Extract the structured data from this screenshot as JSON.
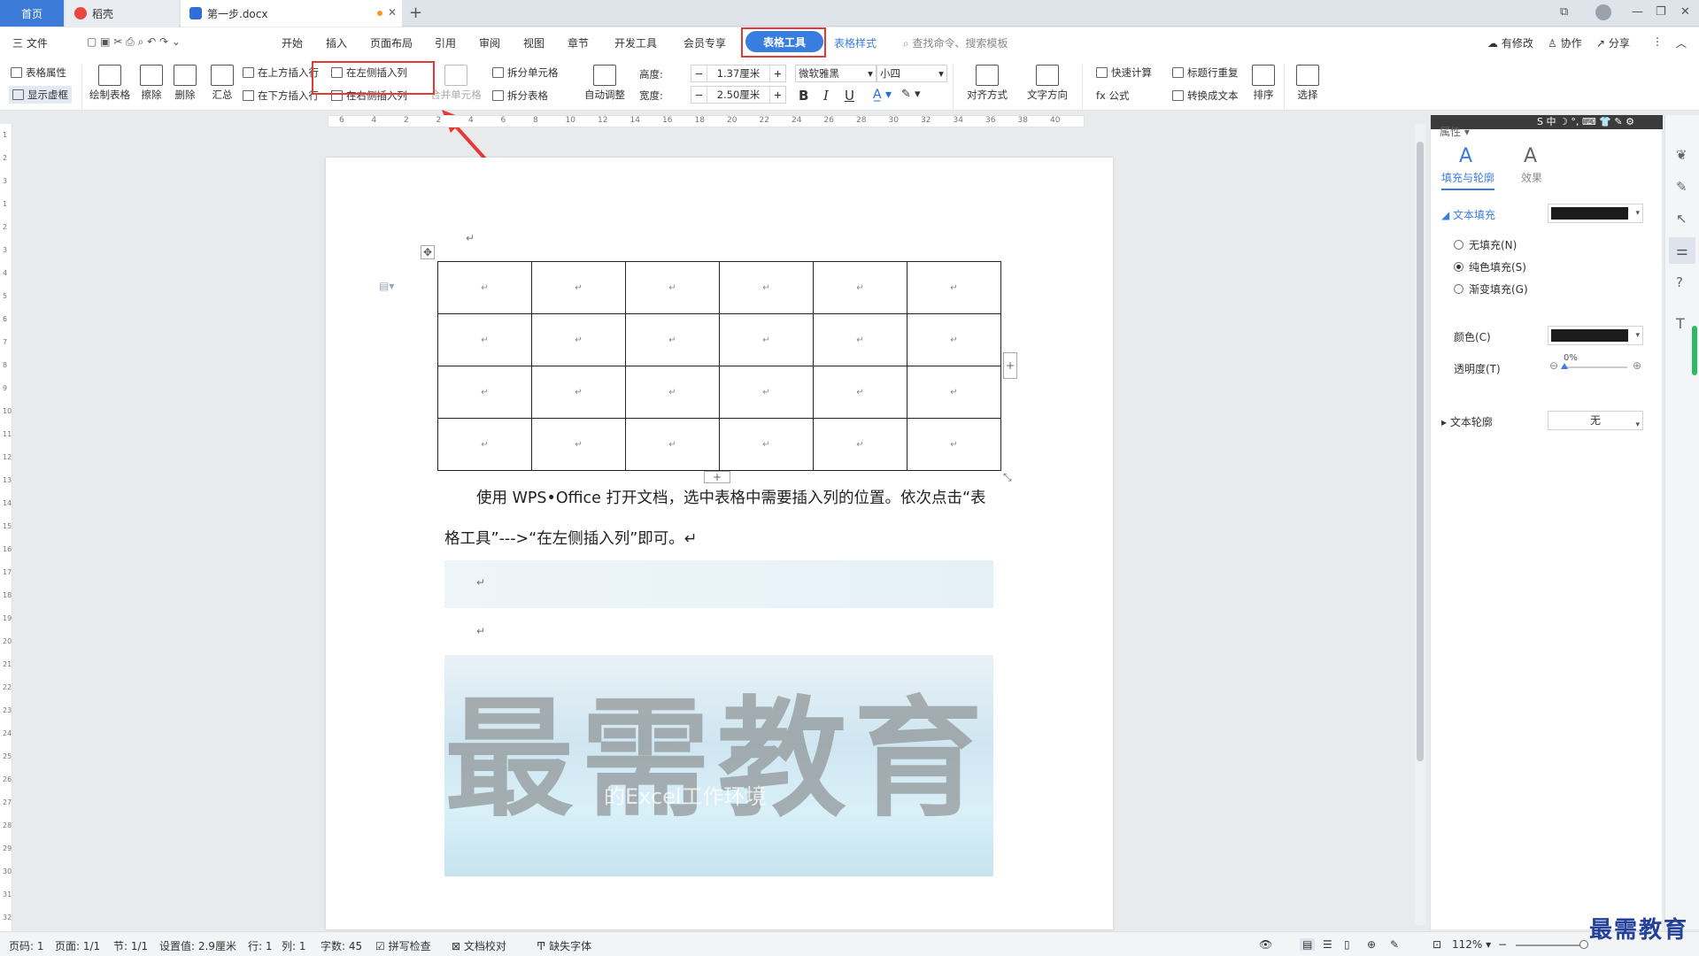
{
  "tabs": {
    "home": "首页",
    "daoke": "稻壳",
    "doc": "第一步.docx"
  },
  "menu": {
    "file": "三 文件",
    "items": [
      "开始",
      "插入",
      "页面布局",
      "引用",
      "审阅",
      "视图",
      "章节",
      "开发工具",
      "会员专享"
    ],
    "active": "表格工具",
    "table_style": "表格样式",
    "search": "查找命令、搜索模板",
    "modified": "有修改",
    "collab": "协作",
    "share": "分享"
  },
  "ribbon": {
    "table_props": "表格属性",
    "show_grid": "显示虚框",
    "draw_table": "绘制表格",
    "erase": "擦除",
    "delete": "删除",
    "summary": "汇总",
    "insert_above": "在上方插入行",
    "insert_below": "在下方插入行",
    "insert_left": "在左侧插入列",
    "insert_right": "在右侧插入列",
    "merge_cells": "合并单元格",
    "split_cells": "拆分单元格",
    "split_table": "拆分表格",
    "auto_adjust": "自动调整",
    "height_label": "高度:",
    "height_value": "1.37厘米",
    "width_label": "宽度:",
    "width_value": "2.50厘米",
    "font_name": "微软雅黑",
    "font_size": "小四",
    "bold": "B",
    "italic": "I",
    "underline": "U",
    "align": "对齐方式",
    "text_dir": "文字方向",
    "quick_calc": "快速计算",
    "formula": "fx 公式",
    "repeat_header": "标题行重复",
    "to_text": "转换成文本",
    "sort": "排序",
    "select": "选择"
  },
  "ruler_ticks": [
    "6",
    "4",
    "2",
    "2",
    "4",
    "6",
    "8",
    "10",
    "12",
    "14",
    "16",
    "18",
    "20",
    "22",
    "24",
    "26",
    "28",
    "30",
    "32",
    "34",
    "36",
    "38",
    "40"
  ],
  "vruler_ticks": [
    "1",
    "2",
    "3",
    "1",
    "2",
    "3",
    "4",
    "5",
    "6",
    "7",
    "8",
    "9",
    "10",
    "11",
    "12",
    "13",
    "14",
    "15",
    "16",
    "17",
    "18",
    "19",
    "20",
    "21",
    "22",
    "23",
    "24",
    "25",
    "26",
    "27",
    "28",
    "29",
    "30",
    "31",
    "32"
  ],
  "document": {
    "para_mark": "↵",
    "line1": "使用 WPS•Office 打开文档，选中表格中需要插入列的位置。依次点击“表",
    "line2": "格工具”--->“在左侧插入列”即可。↵",
    "watermark": "最需教育",
    "banner_sub": "的Excel工作环境",
    "table_rows": 4,
    "table_cols": 6
  },
  "panel": {
    "header": "属性",
    "tab_fill": "填充与轮廓",
    "tab_effect": "效果",
    "text_fill": "文本填充",
    "no_fill": "无填充(N)",
    "solid_fill": "纯色填充(S)",
    "gradient_fill": "渐变填充(G)",
    "color": "颜色(C)",
    "transparency": "透明度(T)",
    "transparency_value": "0%",
    "text_outline": "文本轮廓",
    "outline_value": "无",
    "fill_color": "#1c1c1c",
    "ime": "S 中 ☽ °, ⌨ 👕 ✎ ⚙"
  },
  "status": {
    "page": "页码: 1",
    "pages": "页面: 1/1",
    "section": "节: 1/1",
    "setting": "设置值: 2.9厘米",
    "row": "行: 1",
    "col": "列: 1",
    "words": "字数: 45",
    "spell": "拼写检查",
    "proof": "文档校对",
    "missing_font": "缺失字体",
    "zoom": "112%",
    "logo": "最需教育"
  },
  "colors": {
    "accent": "#3a7de0",
    "highlight": "#e53935",
    "tab_home": "#3c7bd8"
  }
}
